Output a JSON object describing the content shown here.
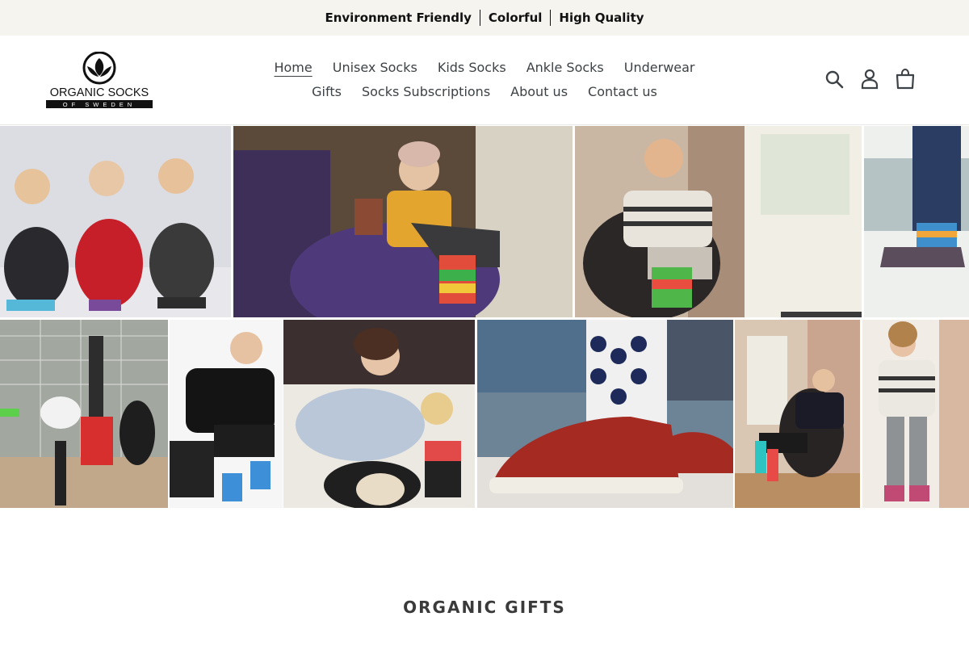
{
  "announcement": {
    "items": [
      "Environment Friendly",
      "Colorful",
      "High Quality"
    ]
  },
  "brand": {
    "logo_text": "ORGANIC SOCKS",
    "logo_subtext": "OF SWEDEN"
  },
  "nav": {
    "row1": [
      "Home",
      "Unisex Socks",
      "Kids Socks",
      "Ankle Socks",
      "Underwear"
    ],
    "row2": [
      "Gifts",
      "Socks Subscriptions",
      "About us",
      "Contact us"
    ],
    "active": "Home"
  },
  "icons": {
    "search": "search-icon",
    "account": "user-icon",
    "cart": "cart-icon"
  },
  "section": {
    "title": "ORGANIC GIFTS"
  },
  "colors": {
    "announcement_bg": "#f5f4ef",
    "text": "#3d4246"
  }
}
